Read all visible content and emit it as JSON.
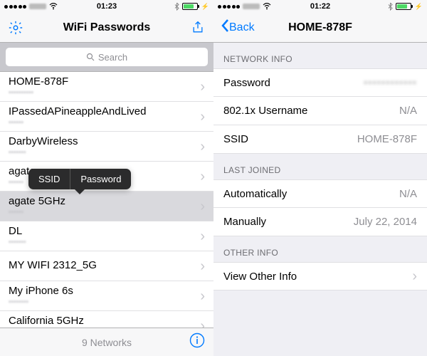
{
  "left": {
    "status": {
      "time": "01:23"
    },
    "title": "WiFi Passwords",
    "search_placeholder": "Search",
    "networks": [
      {
        "ssid": "HOME-878F",
        "pw": "••••••••••"
      },
      {
        "ssid": "IPassedAPineappleAndLived",
        "pw": "••••••"
      },
      {
        "ssid": "DarbyWireless",
        "pw": "•••••••"
      },
      {
        "ssid": "agate",
        "pw": "••••••"
      },
      {
        "ssid": "agate 5GHz",
        "pw": "••••••"
      },
      {
        "ssid": "DL",
        "pw": "•••••••"
      },
      {
        "ssid": "MY WIFI 2312_5G",
        "pw": ""
      },
      {
        "ssid": "My iPhone 6s",
        "pw": "••••••••"
      },
      {
        "ssid": "California 5GHz",
        "pw": "•••••••"
      }
    ],
    "popover": {
      "ssid": "SSID",
      "password": "Password"
    },
    "footer_count": "9 Networks"
  },
  "right": {
    "status": {
      "time": "01:22"
    },
    "back": "Back",
    "title": "HOME-878F",
    "section_network": "NETWORK INFO",
    "rows_network": {
      "password_k": "Password",
      "password_v": "••••••••••••",
      "username_k": "802.1x Username",
      "username_v": "N/A",
      "ssid_k": "SSID",
      "ssid_v": "HOME-878F"
    },
    "section_last": "LAST JOINED",
    "rows_last": {
      "auto_k": "Automatically",
      "auto_v": "N/A",
      "manual_k": "Manually",
      "manual_v": "July 22, 2014"
    },
    "section_other": "OTHER INFO",
    "other_row": "View Other Info"
  }
}
